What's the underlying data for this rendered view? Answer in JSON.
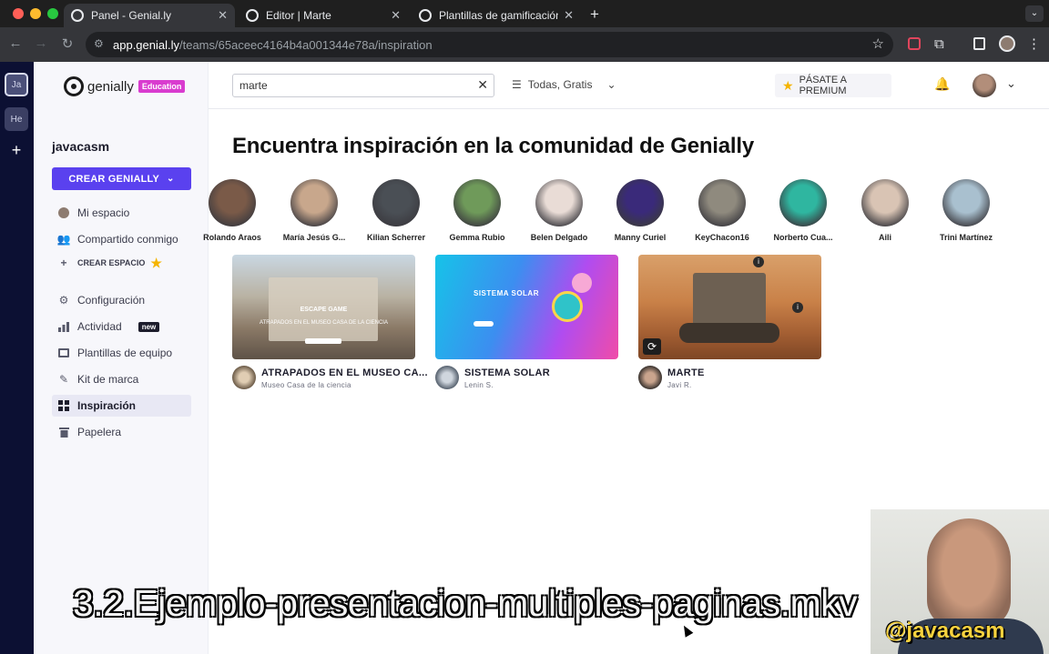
{
  "browser": {
    "tabs": [
      {
        "title": "Panel - Genial.ly",
        "active": true
      },
      {
        "title": "Editor | Marte",
        "active": false
      },
      {
        "title": "Plantillas de gamificación inte",
        "active": false
      }
    ],
    "new_tab_icon": "plus-icon",
    "url_host": "app.genial.ly",
    "url_path": "/teams/65aceec4164b4a001344e78a/inspiration"
  },
  "rail": {
    "spaces": [
      {
        "label": "Ja",
        "active": true
      },
      {
        "label": "He",
        "active": false
      }
    ],
    "add_label": "+"
  },
  "sidebar": {
    "logo_text": "genially",
    "logo_badge": "Education",
    "username": "javacasm",
    "create_button": "CREAR GENIALLY",
    "mi_espacio": "Mi espacio",
    "compartido": "Compartido conmigo",
    "crear_espacio": "CREAR ESPACIO",
    "configuracion": "Configuración",
    "actividad": "Actividad",
    "actividad_badge": "new",
    "plantillas": "Plantillas de equipo",
    "kit": "Kit de marca",
    "inspiracion": "Inspiración",
    "papelera": "Papelera"
  },
  "topbar": {
    "search_value": "marte",
    "filter_label": "Todas, Gratis",
    "premium_label": "PÁSATE A PREMIUM"
  },
  "main": {
    "title": "Encuentra inspiración en la comunidad de Genially",
    "creators": [
      {
        "name": "Rolando Araos",
        "color": "#7a5a48"
      },
      {
        "name": "María Jesús G...",
        "color": "#c8a78c"
      },
      {
        "name": "Kilian Scherrer",
        "color": "#4a4f55"
      },
      {
        "name": "Gemma Rubio",
        "color": "#6f9a5a"
      },
      {
        "name": "Belen Delgado",
        "color": "#e9dcd6"
      },
      {
        "name": "Manny Curiel",
        "color": "#3a2a7a"
      },
      {
        "name": "KeyChacon16",
        "color": "#8f8a7e"
      },
      {
        "name": "Norberto Cua...",
        "color": "#2fb6a0"
      },
      {
        "name": "Aili",
        "color": "#d9c4b4"
      },
      {
        "name": "Trini Martínez",
        "color": "#a9c0cf"
      }
    ],
    "cards": [
      {
        "title": "ATRAPADOS EN EL MUSEO CA...",
        "author": "Museo Casa de la ciencia",
        "thumb_text": "ATRAPADOS EN EL MUSEO CASA DE LA CIENCIA",
        "thumb_kicker": "ESCAPE GAME"
      },
      {
        "title": "SISTEMA SOLAR",
        "author": "Lenin S.",
        "thumb_text": "SISTEMA SOLAR",
        "thumb_kicker": ""
      },
      {
        "title": "MARTE",
        "author": "Javi R.",
        "thumb_text": "",
        "thumb_kicker": ""
      }
    ]
  },
  "overlay": {
    "caption": "3.2.Ejemplo-presentacion-multiples-paginas.mkv",
    "watermark": "@javacasm"
  }
}
